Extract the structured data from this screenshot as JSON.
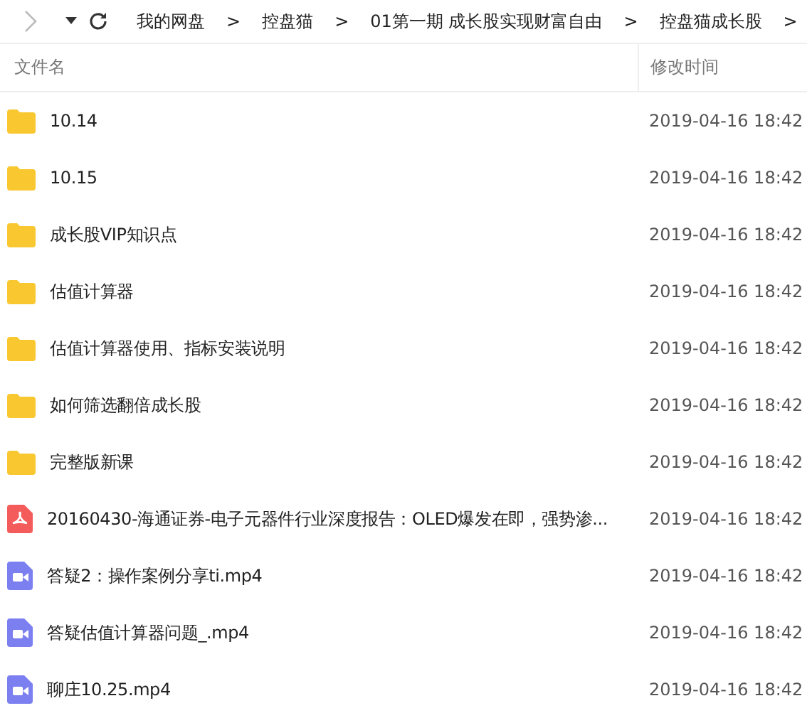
{
  "toolbar": {
    "forward_disabled": true
  },
  "breadcrumb": [
    {
      "label": "我的网盘",
      "separator": ">"
    },
    {
      "label": "控盘猫",
      "separator": ">"
    },
    {
      "label": "01第一期 成长股实现财富自由",
      "separator": ">"
    },
    {
      "label": "控盘猫成长股",
      "separator": ">"
    }
  ],
  "table": {
    "columns": [
      "文件名",
      "修改时间"
    ],
    "rows": [
      {
        "kind": "folder",
        "name": "10.14",
        "modified": "2019-04-16 18:42"
      },
      {
        "kind": "folder",
        "name": "10.15",
        "modified": "2019-04-16 18:42"
      },
      {
        "kind": "folder",
        "name": "成长股VIP知识点",
        "modified": "2019-04-16 18:42"
      },
      {
        "kind": "folder",
        "name": "估值计算器",
        "modified": "2019-04-16 18:42"
      },
      {
        "kind": "folder",
        "name": "估值计算器使用、指标安装说明",
        "modified": "2019-04-16 18:42"
      },
      {
        "kind": "folder",
        "name": "如何筛选翻倍成长股",
        "modified": "2019-04-16 18:42"
      },
      {
        "kind": "folder",
        "name": "完整版新课",
        "modified": "2019-04-16 18:42"
      },
      {
        "kind": "pdf",
        "name": "20160430-海通证券-电子元器件行业深度报告：OLED爆发在即，强势渗...",
        "modified": "2019-04-16 18:42"
      },
      {
        "kind": "video",
        "name": "答疑2：操作案例分享ti.mp4",
        "modified": "2019-04-16 18:42"
      },
      {
        "kind": "video",
        "name": "答疑估值计算器问题_.mp4",
        "modified": "2019-04-16 18:42"
      },
      {
        "kind": "video",
        "name": "聊庄10.25.mp4",
        "modified": "2019-04-16 18:42"
      }
    ]
  }
}
